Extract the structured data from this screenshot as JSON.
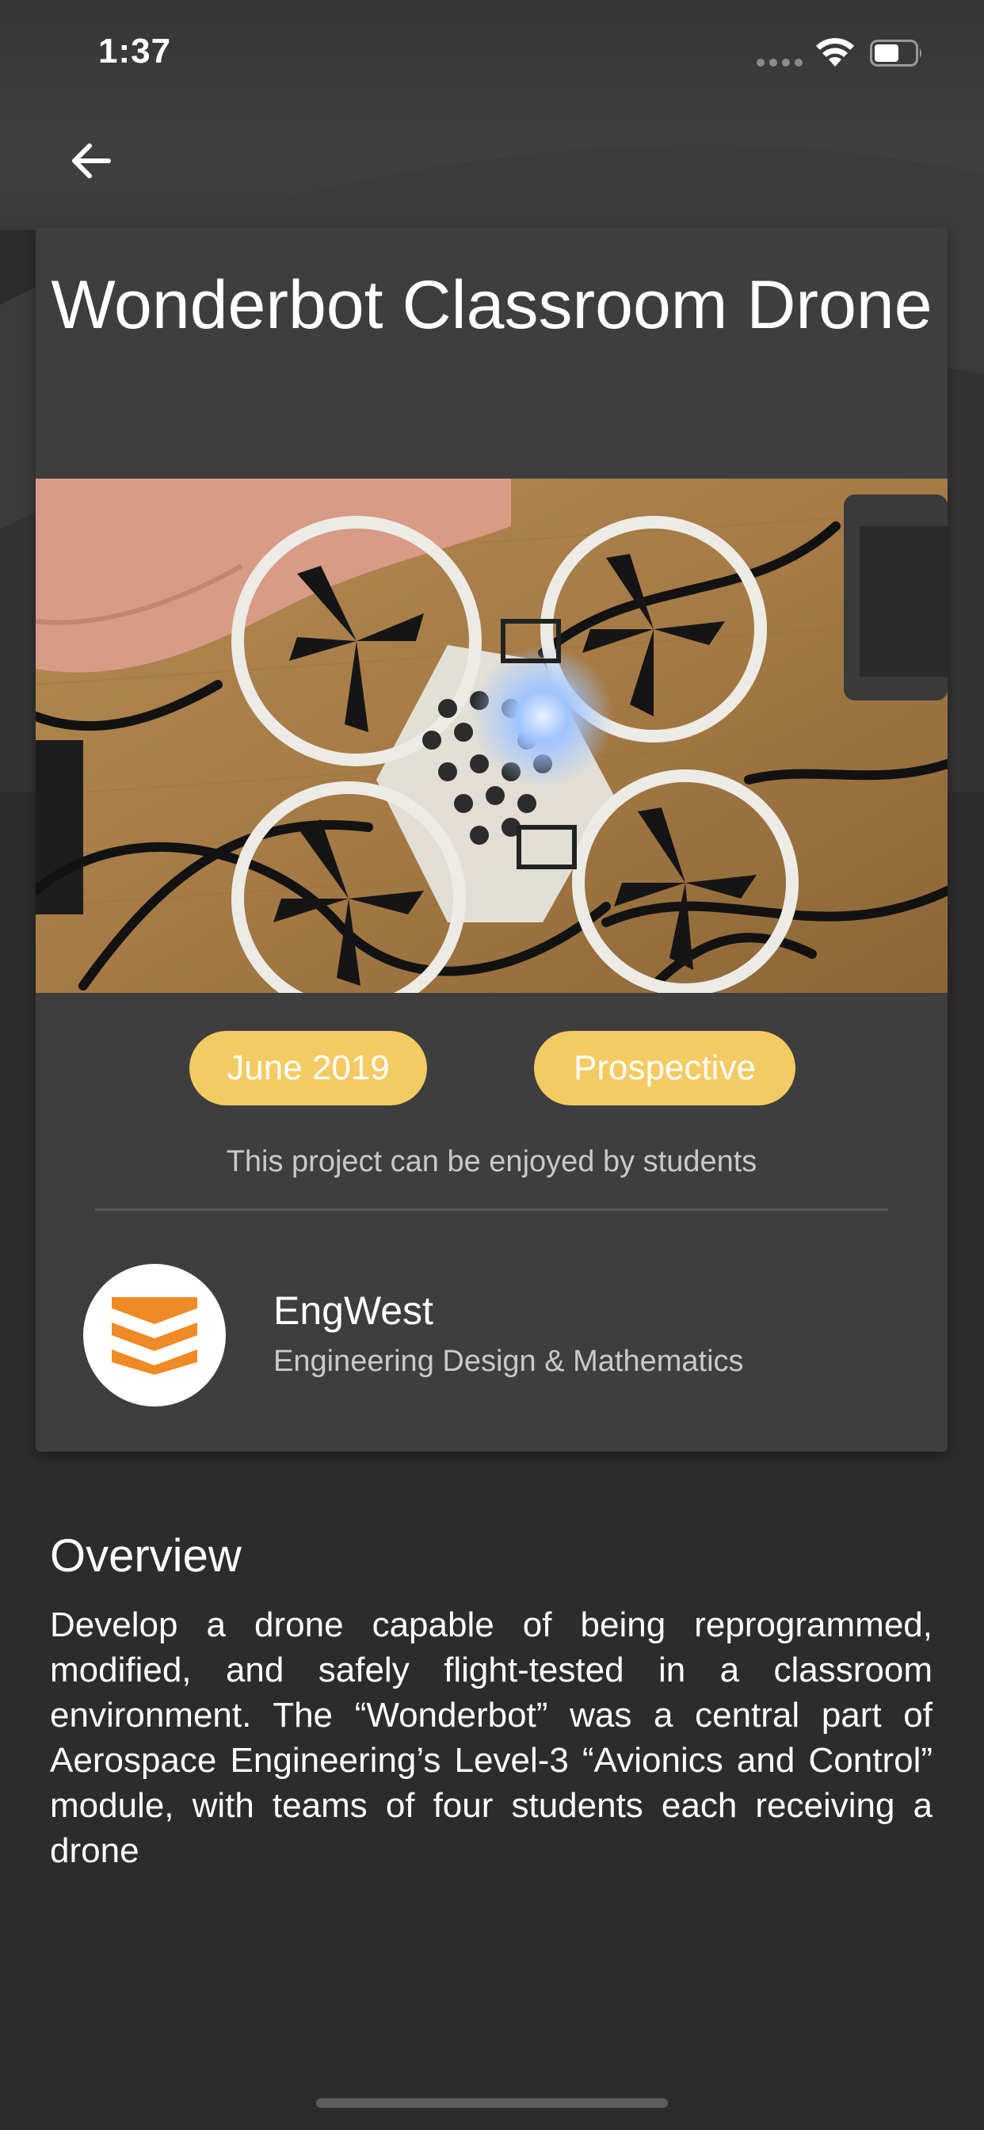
{
  "status_bar": {
    "time": "1:37"
  },
  "nav": {
    "back_icon": "arrow-left-icon"
  },
  "project": {
    "title": "Wonderbot Classroom Drone",
    "photo_subject": "drone-photo",
    "date_chip": "June 2019",
    "status_chip": "Prospective",
    "audience_text": "This project can be enjoyed by students"
  },
  "organisation": {
    "name": "EngWest",
    "department": "Engineering Design & Mathematics",
    "logo_icon": "engwest-logo-icon"
  },
  "overview": {
    "heading": "Overview",
    "body": "Develop a drone capable of being reprogrammed, modified, and safely flight-tested in a classroom environment. The “Wonderbot” was a central part of Aerospace Engineering’s Level-3 “Avionics and Control” module, with teams of four students each receiving a drone"
  },
  "colors": {
    "background": "#2c2c2d",
    "card": "#3e3e3f",
    "chip": "#f4cb63",
    "logo_orange": "#f08a24"
  }
}
